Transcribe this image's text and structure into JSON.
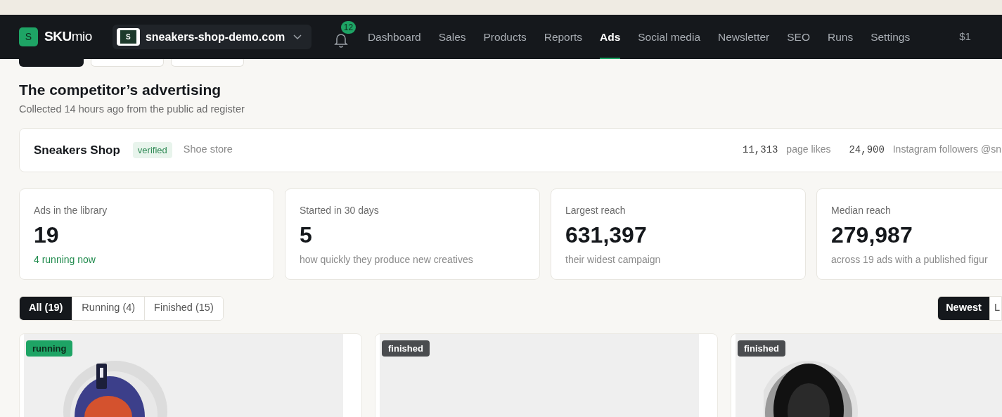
{
  "brand": {
    "logo_letter": "S",
    "name": "SKU",
    "name_light": "mio"
  },
  "shop_switcher": {
    "letter": "S",
    "domain": "sneakers-shop-demo.com"
  },
  "notifications": {
    "count": "12"
  },
  "nav": [
    {
      "label": "Dashboard",
      "selected": false
    },
    {
      "label": "Sales",
      "selected": false
    },
    {
      "label": "Products",
      "selected": false
    },
    {
      "label": "Reports",
      "selected": false
    },
    {
      "label": "Ads",
      "selected": true
    },
    {
      "label": "Social media",
      "selected": false
    },
    {
      "label": "Newsletter",
      "selected": false
    },
    {
      "label": "SEO",
      "selected": false
    },
    {
      "label": "Runs",
      "selected": false
    },
    {
      "label": "Settings",
      "selected": false
    }
  ],
  "nav_balance": "$1",
  "hidden_tabs": [
    {
      "selected": true
    },
    {
      "selected": false
    },
    {
      "selected": false
    }
  ],
  "title": "The competitor’s advertising",
  "subtitle": "Collected 14 hours ago from the public ad register",
  "competitor": {
    "name": "Sneakers Shop",
    "badge": "verified",
    "category": "Shoe store",
    "stats": [
      {
        "count": "11,313",
        "unit": "page likes"
      },
      {
        "count": "24,900",
        "unit": "Instagram followers @sn"
      }
    ]
  },
  "stats": [
    {
      "label": "Ads in the library",
      "value": "19",
      "note": "4 running now",
      "highlight": true
    },
    {
      "label": "Started in 30 days",
      "value": "5",
      "note": "how quickly they produce new creatives",
      "highlight": false
    },
    {
      "label": "Largest reach",
      "value": "631,397",
      "note": "their widest campaign",
      "highlight": false
    },
    {
      "label": "Median reach",
      "value": "279,987",
      "note": "across 19 ads with a published figur",
      "highlight": false
    }
  ],
  "filters": [
    {
      "label": "All (19)",
      "selected": true
    },
    {
      "label": "Running (4)",
      "selected": false
    },
    {
      "label": "Finished (15)",
      "selected": false
    }
  ],
  "sort": [
    {
      "label": "Newest",
      "selected": true
    },
    {
      "label": "L",
      "selected": false
    }
  ],
  "ads": [
    {
      "status": "running",
      "kind": "picture"
    },
    {
      "status": "finished"
    },
    {
      "status": "finished",
      "kind": "picture"
    }
  ]
}
